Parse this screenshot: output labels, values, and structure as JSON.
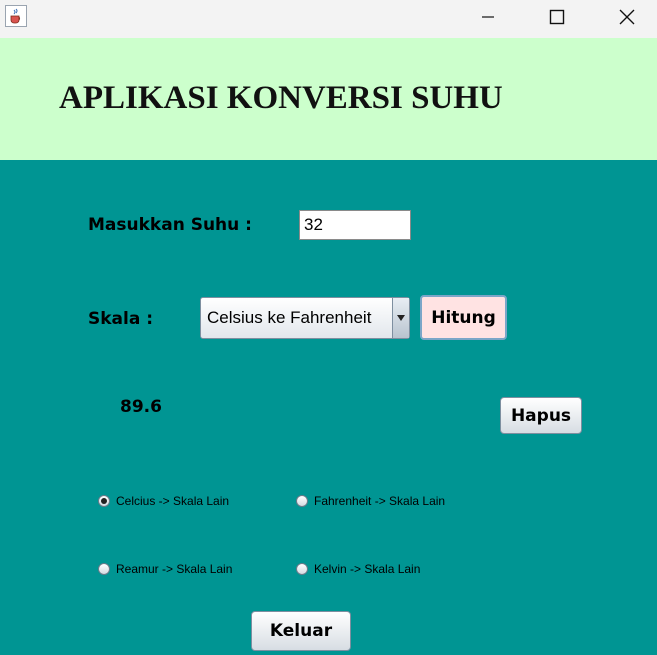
{
  "window": {
    "app_icon": "java-cup-icon"
  },
  "header": {
    "title": "APLIKASI KONVERSI SUHU",
    "background": "#ccffcc"
  },
  "form": {
    "suhu_label": "Masukkan Suhu   :",
    "suhu_value": "32",
    "skala_label": "Skala   :",
    "skala_selected": "Celsius ke Fahrenheit",
    "hitung_button": "Hitung",
    "result": "89.6",
    "hapus_button": "Hapus",
    "keluar_button": "Keluar"
  },
  "radios": [
    {
      "label": "Celcius -> Skala Lain",
      "checked": true
    },
    {
      "label": "Fahrenheit -> Skala Lain",
      "checked": false
    },
    {
      "label": "Reamur -> Skala Lain",
      "checked": false
    },
    {
      "label": "Kelvin -> Skala Lain",
      "checked": false
    }
  ],
  "colors": {
    "panel_background": "#009593",
    "hitung_background": "#ffe3e3"
  }
}
